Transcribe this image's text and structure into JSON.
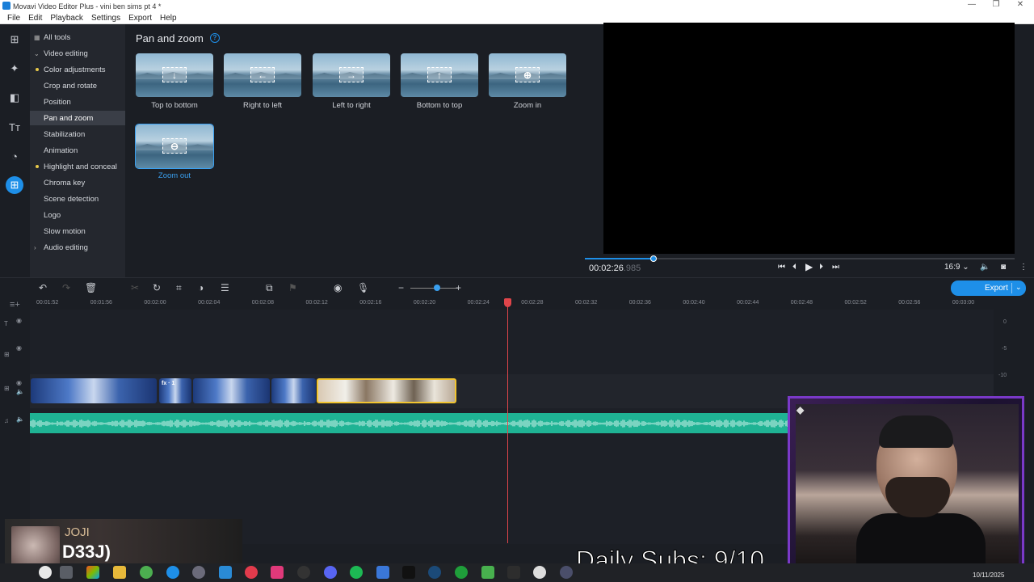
{
  "window": {
    "title": "Movavi Video Editor Plus - vini ben sims pt 4 *"
  },
  "menu": [
    "File",
    "Edit",
    "Playback",
    "Settings",
    "Export",
    "Help"
  ],
  "tools": {
    "all_tools": "All tools",
    "items": [
      {
        "label": "Video editing"
      },
      {
        "label": "Color adjustments"
      },
      {
        "label": "Crop and rotate"
      },
      {
        "label": "Position"
      },
      {
        "label": "Pan and zoom"
      },
      {
        "label": "Stabilization"
      },
      {
        "label": "Animation"
      },
      {
        "label": "Highlight and conceal"
      },
      {
        "label": "Chroma key"
      },
      {
        "label": "Scene detection"
      },
      {
        "label": "Logo"
      },
      {
        "label": "Slow motion"
      },
      {
        "label": "Audio editing"
      }
    ],
    "selected": "Pan and zoom"
  },
  "panel": {
    "title": "Pan and zoom",
    "presets": [
      {
        "label": "Top to bottom",
        "icon": "arrow-down-icon",
        "glyph": "↓"
      },
      {
        "label": "Right to left",
        "icon": "arrow-left-icon",
        "glyph": "←"
      },
      {
        "label": "Left to right",
        "icon": "arrow-right-icon",
        "glyph": "→"
      },
      {
        "label": "Bottom to top",
        "icon": "arrow-up-icon",
        "glyph": "↑"
      },
      {
        "label": "Zoom in",
        "icon": "zoom-in-icon",
        "glyph": "⊕"
      },
      {
        "label": "Zoom out",
        "icon": "zoom-out-icon",
        "glyph": "⊖"
      }
    ]
  },
  "player": {
    "time_main": "00:02:26",
    "time_ms": ".985",
    "aspect": "16:9",
    "progress": 0.16
  },
  "timeline": {
    "export_label": "Export",
    "ruler": [
      "00:01:52",
      "00:01:56",
      "00:02:00",
      "00:02:04",
      "00:02:08",
      "00:02:12",
      "00:02:16",
      "00:02:20",
      "00:02:24",
      "00:02:28",
      "00:02:32",
      "00:02:36",
      "00:02:40",
      "00:02:44",
      "00:02:48",
      "00:02:52",
      "00:02:56",
      "00:03:00"
    ],
    "fx_badge": "fx · 1",
    "meter_labels": [
      "0",
      "-5",
      "-10"
    ]
  },
  "overlay": {
    "artist": "JOJI",
    "track": "D33J)",
    "subs": "Daily Subs: 9/10"
  },
  "taskbar": {
    "date": "10/11/2025"
  },
  "colors": {
    "accent": "#1e8fe8",
    "playhead": "#e0454a",
    "audio": "#1fb394",
    "selected_clip": "#f1c430"
  }
}
